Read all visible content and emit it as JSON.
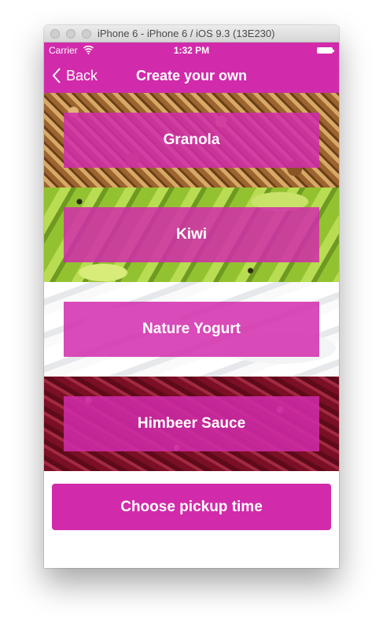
{
  "window": {
    "title": "iPhone 6 - iPhone 6 / iOS 9.3 (13E230)"
  },
  "statusbar": {
    "carrier": "Carrier",
    "time": "1:32 PM"
  },
  "navbar": {
    "back_label": "Back",
    "title": "Create your own"
  },
  "ingredients": [
    {
      "label": "Granola",
      "background": "granola"
    },
    {
      "label": "Kiwi",
      "background": "kiwi"
    },
    {
      "label": "Nature Yogurt",
      "background": "yogurt"
    },
    {
      "label": "Himbeer Sauce",
      "background": "raspberry-sauce"
    }
  ],
  "cta": {
    "label": "Choose pickup time"
  },
  "colors": {
    "accent": "#d12bab"
  }
}
